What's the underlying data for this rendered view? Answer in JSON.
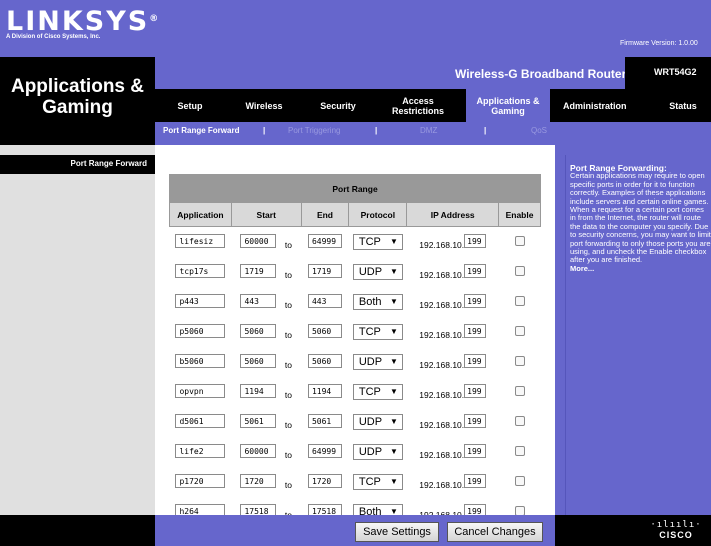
{
  "header": {
    "logo": "LINKSYS",
    "logo_mark": "®",
    "logo_sub": "A Division of Cisco Systems, Inc.",
    "firmware": "Firmware Version: 1.0.00"
  },
  "section_title": "Applications & Gaming",
  "product": {
    "name": "Wireless-G Broadband Router",
    "model": "WRT54G2"
  },
  "tabs": [
    {
      "label": "Setup"
    },
    {
      "label": "Wireless"
    },
    {
      "label": "Security"
    },
    {
      "label": "Access Restrictions"
    },
    {
      "label": "Applications & Gaming",
      "active": true
    },
    {
      "label": "Administration"
    },
    {
      "label": "Status"
    }
  ],
  "subtabs": [
    {
      "label": "Port Range Forward",
      "active": true
    },
    {
      "label": "Port Triggering"
    },
    {
      "label": "DMZ"
    },
    {
      "label": "QoS"
    }
  ],
  "subtab_separator": "|",
  "side_label": "Port Range Forward",
  "table": {
    "group_header": "Port Range",
    "columns": [
      "Application",
      "Start",
      "End",
      "Protocol",
      "IP Address",
      "Enable"
    ],
    "to_label": "to",
    "ip_prefix": "192.168.10.",
    "protocol_arrow": "▼",
    "rows": [
      {
        "app": "lifesiz",
        "start": "60000",
        "end": "64999",
        "protocol": "TCP",
        "ip_last": "199",
        "enabled": false
      },
      {
        "app": "tcp17s",
        "start": "1719",
        "end": "1719",
        "protocol": "UDP",
        "ip_last": "199",
        "enabled": false
      },
      {
        "app": "p443",
        "start": "443",
        "end": "443",
        "protocol": "Both",
        "ip_last": "199",
        "enabled": false
      },
      {
        "app": "p5060",
        "start": "5060",
        "end": "5060",
        "protocol": "TCP",
        "ip_last": "199",
        "enabled": false
      },
      {
        "app": "b5060",
        "start": "5060",
        "end": "5060",
        "protocol": "UDP",
        "ip_last": "199",
        "enabled": false
      },
      {
        "app": "opvpn",
        "start": "1194",
        "end": "1194",
        "protocol": "TCP",
        "ip_last": "199",
        "enabled": false
      },
      {
        "app": "d5061",
        "start": "5061",
        "end": "5061",
        "protocol": "UDP",
        "ip_last": "199",
        "enabled": false
      },
      {
        "app": "life2",
        "start": "60000",
        "end": "64999",
        "protocol": "UDP",
        "ip_last": "199",
        "enabled": false
      },
      {
        "app": "p1720",
        "start": "1720",
        "end": "1720",
        "protocol": "TCP",
        "ip_last": "199",
        "enabled": false
      },
      {
        "app": "h264",
        "start": "17518",
        "end": "17518",
        "protocol": "Both",
        "ip_last": "199",
        "enabled": false
      }
    ]
  },
  "help": {
    "title": "Port Range Forwarding:",
    "body": "Certain applications may require to open specific ports in order for it to function correctly. Examples of these applications include servers and certain online games. When a request for a certain port comes in from the Internet, the router will route the data to the computer you specify. Due to security concerns, you may want to limit port forwarding to only those ports you are using, and uncheck the Enable checkbox after you are finished.",
    "more": "More..."
  },
  "buttons": {
    "save": "Save Settings",
    "cancel": "Cancel Changes"
  },
  "footer_logo": {
    "bars": "·ılıılı·",
    "word": "CISCO"
  },
  "colors": {
    "purple": "#6666cc",
    "black": "#000000",
    "gray": "#e0e0e0",
    "table_header": "#999999"
  }
}
